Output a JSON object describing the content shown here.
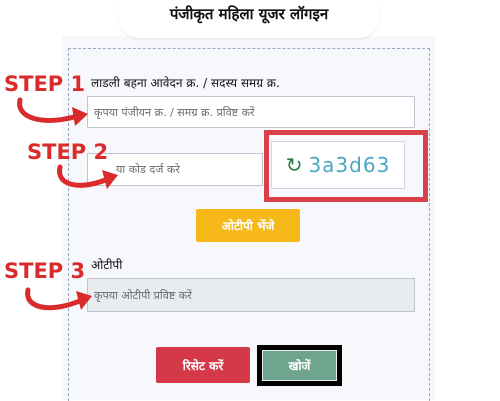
{
  "header": {
    "title": "पंजीकृत महिला यूजर लॉगइन"
  },
  "form": {
    "id_label": "लाडली बहना आवेदन क्र. / सदस्य समग्र क्र.",
    "id_placeholder": "कृपया पंजीयन क्र. / समग्र क्र. प्रविष्ट करें",
    "captcha_placeholder": "या कोड दर्ज करे",
    "captcha_code": "3a3d63",
    "otp_button": "ओटीपी भेंजे",
    "otp_label": "ओटीपी",
    "otp_placeholder": "कृपया ओटीपी प्रविष्ट करें",
    "reset_button": "रिसेट करें",
    "search_button": "खोजें"
  },
  "steps": {
    "step1": "STEP 1",
    "step2": "STEP 2",
    "step3": "STEP 3"
  },
  "colors": {
    "step_red": "#d92b2b",
    "otp_button": "#f7b919",
    "reset_button": "#d53847",
    "search_button": "#6fa58f",
    "highlight_border": "#d9404a"
  }
}
